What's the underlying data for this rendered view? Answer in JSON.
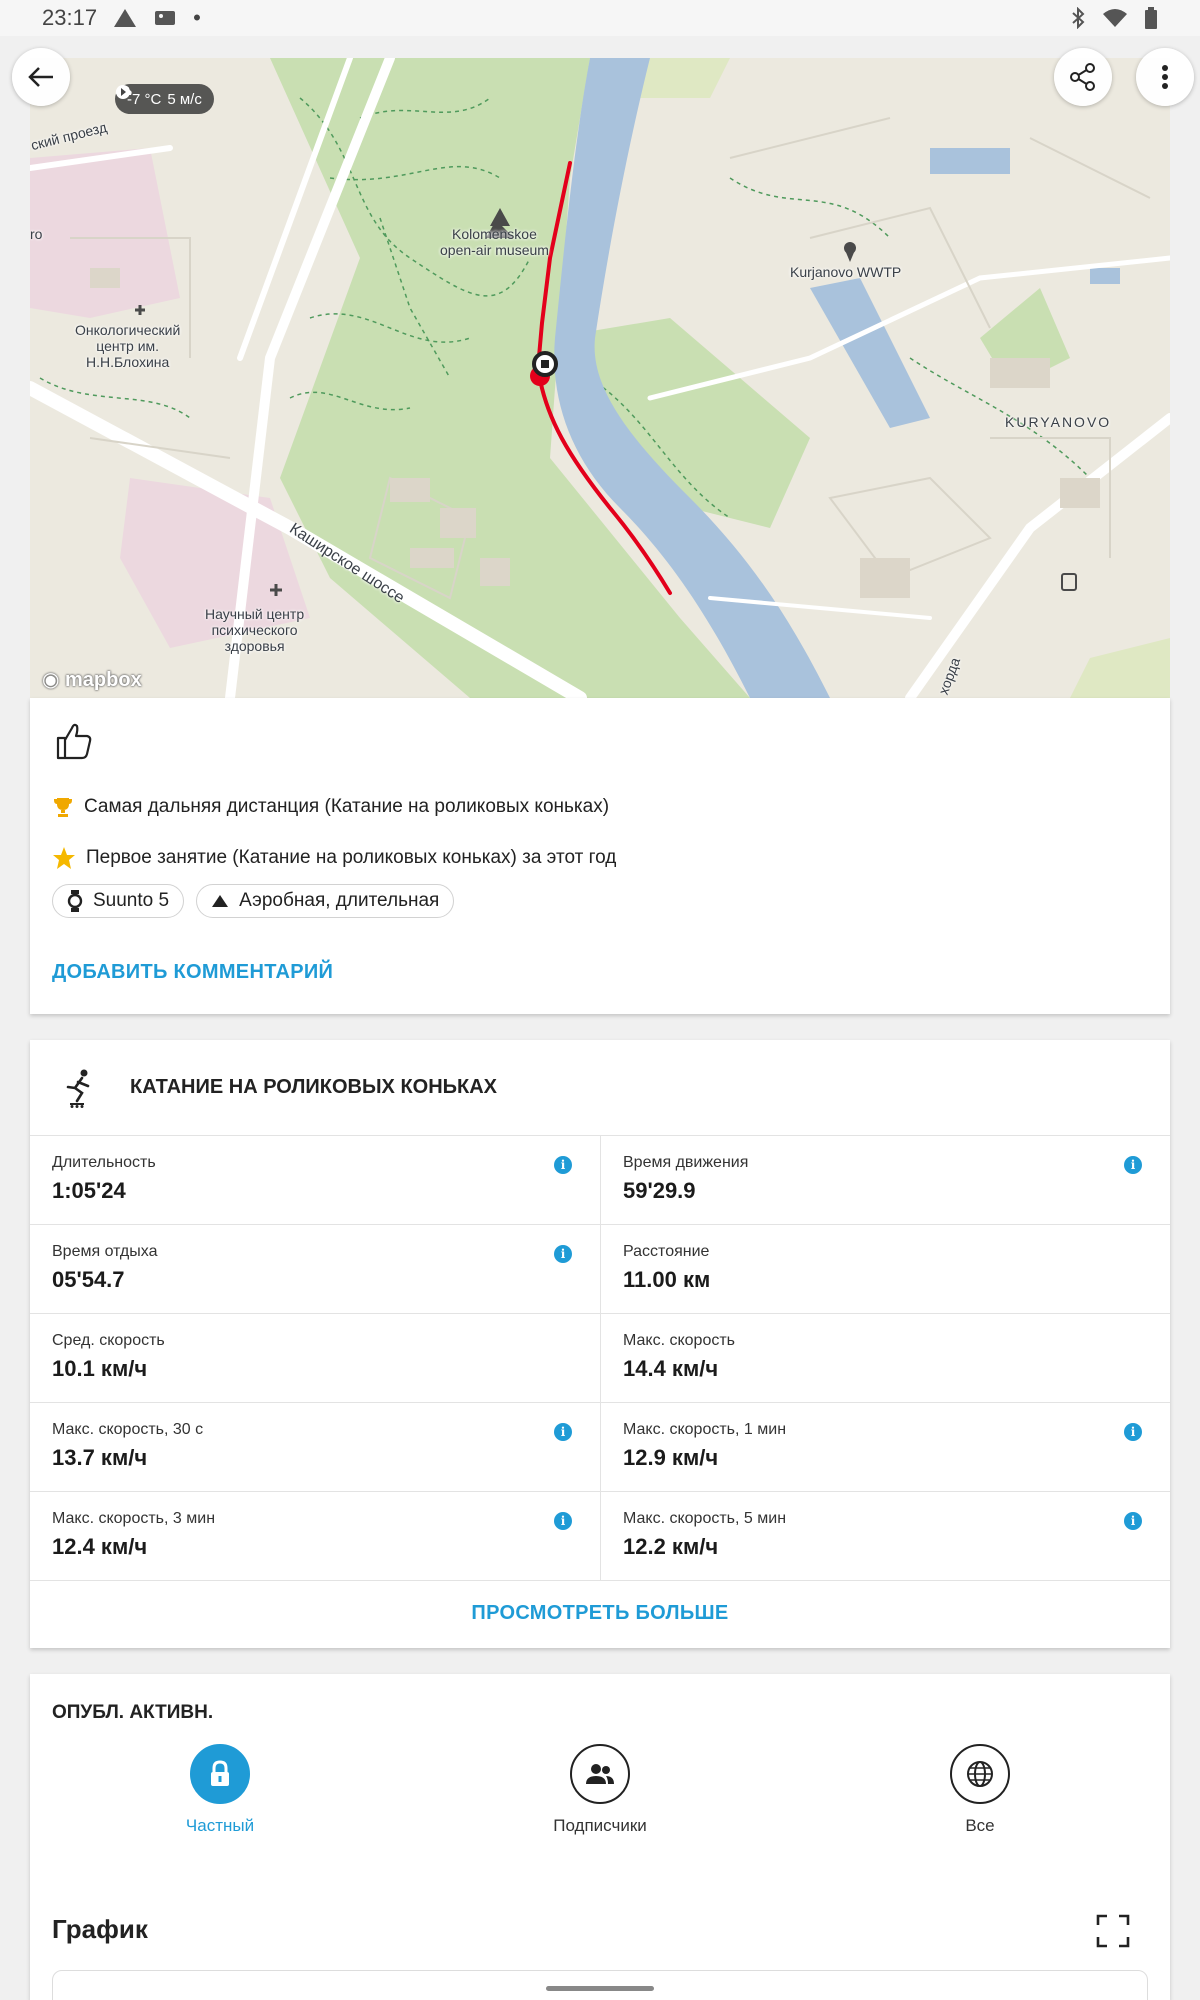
{
  "status_bar": {
    "time": "23:17",
    "dot": "•"
  },
  "map": {
    "weather_temp": "-7 °C",
    "weather_wind": "5 м/с",
    "labels": {
      "proezd": "ский проезд",
      "ro": "ro",
      "museum": "Kolomenskoe\nopen-air museum",
      "wwtp": "Kurjanovo WWTP",
      "kuryanovo": "KURYANOVO",
      "onko": "Онкологический\nцентр им.\nН.Н.Блохина",
      "shosse": "Каширское шоссе",
      "psych": "Научный центр\nпсихического\nздоровья",
      "horda": "хорда"
    },
    "attribution": "mapbox"
  },
  "summary": {
    "achievements": [
      "Самая дальняя дистанция (Катание на роликовых коньках)",
      "Первое занятие (Катание на роликовых коньках) за этот год"
    ],
    "chips": [
      "Suunto 5",
      "Аэробная, длительная"
    ],
    "add_comment": "ДОБАВИТЬ КОММЕНТАРИЙ"
  },
  "activity": {
    "title": "КАТАНИЕ НА РОЛИКОВЫХ КОНЬКАХ",
    "stats": [
      {
        "label": "Длительность",
        "value": "1:05'24"
      },
      {
        "label": "Время движения",
        "value": "59'29.9"
      },
      {
        "label": "Время отдыха",
        "value": "05'54.7"
      },
      {
        "label": "Расстояние",
        "value": "11.00 км"
      },
      {
        "label": "Сред. скорость",
        "value": "10.1 км/ч"
      },
      {
        "label": "Макс. скорость",
        "value": "14.4 км/ч"
      },
      {
        "label": "Макс. скорость, 30 с",
        "value": "13.7 км/ч"
      },
      {
        "label": "Макс. скорость, 1 мин",
        "value": "12.9 км/ч"
      },
      {
        "label": "Макс. скорость, 3 мин",
        "value": "12.4 км/ч"
      },
      {
        "label": "Макс. скорость, 5 мин",
        "value": "12.2 км/ч"
      }
    ],
    "info_glyph": "i",
    "view_more": "ПРОСМОТРЕТЬ БОЛЬШЕ"
  },
  "publish": {
    "title": "ОПУБЛ. АКТИВН.",
    "options": [
      "Частный",
      "Подписчики",
      "Все"
    ],
    "active": "Частный"
  },
  "graph": {
    "title": "График"
  },
  "colors": {
    "accent": "#1f9bd6",
    "route": "#e3001b"
  }
}
